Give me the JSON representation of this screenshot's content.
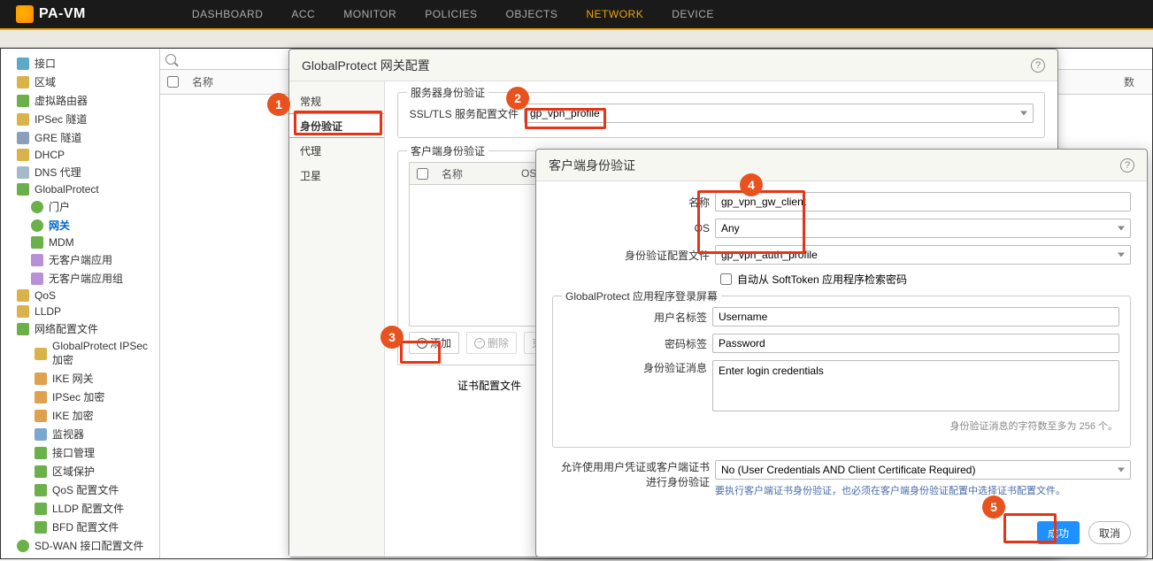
{
  "header": {
    "logo_text": "PA-VM",
    "nav": [
      "DASHBOARD",
      "ACC",
      "MONITOR",
      "POLICIES",
      "OBJECTS",
      "NETWORK",
      "DEVICE"
    ],
    "active": "NETWORK"
  },
  "sidebar": {
    "items": [
      {
        "label": "接口",
        "color": "#5da9c8"
      },
      {
        "label": "区域",
        "color": "#d9b24a"
      },
      {
        "label": "虚拟路由器",
        "color": "#6bb04a"
      },
      {
        "label": "IPSec 隧道",
        "color": "#d9b24a"
      },
      {
        "label": "GRE 隧道",
        "color": "#8aa0b8"
      },
      {
        "label": "DHCP",
        "color": "#d9b24a"
      },
      {
        "label": "DNS 代理",
        "color": "#a6b9c8"
      },
      {
        "label": "GlobalProtect",
        "color": "#6bb04a"
      }
    ],
    "gp_children": [
      {
        "label": "门户",
        "color": "#6bb04a"
      },
      {
        "label": "网关",
        "color": "#6bb04a",
        "active": true
      },
      {
        "label": "MDM",
        "color": "#6bb04a"
      },
      {
        "label": "无客户端应用",
        "color": "#b890d8"
      },
      {
        "label": "无客户端应用组",
        "color": "#b890d8"
      }
    ],
    "items2": [
      {
        "label": "QoS",
        "color": "#d9b24a"
      },
      {
        "label": "LLDP",
        "color": "#d9b24a"
      },
      {
        "label": "网络配置文件",
        "color": "#6bb04a"
      }
    ],
    "net_children": [
      {
        "label": "GlobalProtect IPSec 加密",
        "color": "#d9b24a"
      },
      {
        "label": "IKE 网关",
        "color": "#e0a14e"
      },
      {
        "label": "IPSec 加密",
        "color": "#e0a14e"
      },
      {
        "label": "IKE 加密",
        "color": "#e0a14e"
      },
      {
        "label": "监视器",
        "color": "#7aa8d0"
      },
      {
        "label": "接口管理",
        "color": "#6bb04a"
      },
      {
        "label": "区域保护",
        "color": "#6bb04a"
      },
      {
        "label": "QoS 配置文件",
        "color": "#6bb04a"
      },
      {
        "label": "LLDP 配置文件",
        "color": "#6bb04a"
      },
      {
        "label": "BFD 配置文件",
        "color": "#6bb04a"
      }
    ],
    "sdwan": {
      "label": "SD-WAN 接口配置文件",
      "color": "#6bb04a"
    }
  },
  "content_table": {
    "col_name": "名称",
    "col_count": "数"
  },
  "dialog1": {
    "title": "GlobalProtect 网关配置",
    "tabs": {
      "general": "常规",
      "auth": "身份验证",
      "proxy": "代理",
      "satellite": "卫星"
    },
    "server_auth_title": "服务器身份验证",
    "ssl_label": "SSL/TLS 服务配置文件",
    "ssl_value": "gp_vpn_profile",
    "client_auth_title": "客户端身份验证",
    "cols": {
      "name": "名称",
      "os": "OS"
    },
    "add": "添加",
    "delete": "删除",
    "clone": "克",
    "cert_label": "证书配置文件"
  },
  "dialog2": {
    "title": "客户端身份验证",
    "name_label": "名称",
    "name_value": "gp_vpn_gw_client",
    "os_label": "OS",
    "os_value": "Any",
    "auth_label": "身份验证配置文件",
    "auth_value": "gp_vpn_auth_profile",
    "softtoken_label": "自动从 SoftToken 应用程序检索密码",
    "login_screen_title": "GlobalProtect 应用程序登录屏幕",
    "user_label": "用户名标签",
    "user_value": "Username",
    "pass_label": "密码标签",
    "pass_value": "Password",
    "msg_label": "身份验证消息",
    "msg_value": "Enter login credentials",
    "msg_hint": "身份验证消息的字符数至多为 256 个。",
    "allow_label": "允许使用用户凭证或客户端证书进行身份验证",
    "allow_value": "No (User Credentials AND Client Certificate Required)",
    "allow_hint": "要执行客户端证书身份验证，也必须在客户端身份验证配置中选择证书配置文件。",
    "ok": "成功",
    "cancel": "取消"
  },
  "callouts": {
    "b1": "1",
    "b2": "2",
    "b3": "3",
    "b4": "4",
    "b5": "5"
  }
}
